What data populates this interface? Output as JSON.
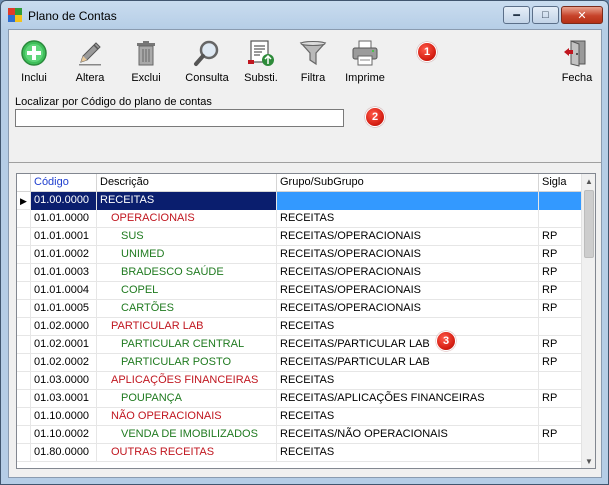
{
  "window": {
    "title": "Plano de Contas"
  },
  "toolbar": {
    "inclui": "Inclui",
    "altera": "Altera",
    "exclui": "Exclui",
    "consulta": "Consulta",
    "substi": "Substi.",
    "filtra": "Filtra",
    "imprime": "Imprime",
    "fecha": "Fecha"
  },
  "markers": {
    "m1": "1",
    "m2": "2",
    "m3": "3"
  },
  "search": {
    "label": "Localizar por Código do plano de contas",
    "value": ""
  },
  "grid": {
    "headers": {
      "codigo": "Código",
      "descricao": "Descrição",
      "grupo": "Grupo/SubGrupo",
      "sigla": "Sigla"
    },
    "rows": [
      {
        "codigo": "01.00.0000",
        "descricao": "RECEITAS",
        "grupo": "",
        "sigla": "",
        "level": 1
      },
      {
        "codigo": "01.01.0000",
        "descricao": "OPERACIONAIS",
        "grupo": "RECEITAS",
        "sigla": "",
        "level": 2
      },
      {
        "codigo": "01.01.0001",
        "descricao": "SUS",
        "grupo": "RECEITAS/OPERACIONAIS",
        "sigla": "RP",
        "level": 3
      },
      {
        "codigo": "01.01.0002",
        "descricao": "UNIMED",
        "grupo": "RECEITAS/OPERACIONAIS",
        "sigla": "RP",
        "level": 3
      },
      {
        "codigo": "01.01.0003",
        "descricao": "BRADESCO SAÚDE",
        "grupo": "RECEITAS/OPERACIONAIS",
        "sigla": "RP",
        "level": 3
      },
      {
        "codigo": "01.01.0004",
        "descricao": "COPEL",
        "grupo": "RECEITAS/OPERACIONAIS",
        "sigla": "RP",
        "level": 3
      },
      {
        "codigo": "01.01.0005",
        "descricao": "CARTÕES",
        "grupo": "RECEITAS/OPERACIONAIS",
        "sigla": "RP",
        "level": 3
      },
      {
        "codigo": "01.02.0000",
        "descricao": "PARTICULAR LAB",
        "grupo": "RECEITAS",
        "sigla": "",
        "level": 2
      },
      {
        "codigo": "01.02.0001",
        "descricao": "PARTICULAR CENTRAL",
        "grupo": "RECEITAS/PARTICULAR LAB",
        "sigla": "RP",
        "level": 3
      },
      {
        "codigo": "01.02.0002",
        "descricao": "PARTICULAR POSTO",
        "grupo": "RECEITAS/PARTICULAR LAB",
        "sigla": "RP",
        "level": 3
      },
      {
        "codigo": "01.03.0000",
        "descricao": "APLICAÇÕES FINANCEIRAS",
        "grupo": "RECEITAS",
        "sigla": "",
        "level": 2
      },
      {
        "codigo": "01.03.0001",
        "descricao": "POUPANÇA",
        "grupo": "RECEITAS/APLICAÇÕES FINANCEIRAS",
        "sigla": "RP",
        "level": 3
      },
      {
        "codigo": "01.10.0000",
        "descricao": "NÃO OPERACIONAIS",
        "grupo": "RECEITAS",
        "sigla": "",
        "level": 2
      },
      {
        "codigo": "01.10.0002",
        "descricao": "VENDA DE IMOBILIZADOS",
        "grupo": "RECEITAS/NÃO OPERACIONAIS",
        "sigla": "RP",
        "level": 3
      },
      {
        "codigo": "01.80.0000",
        "descricao": "OUTRAS RECEITAS",
        "grupo": "RECEITAS",
        "sigla": "",
        "level": 2
      }
    ]
  },
  "colors": {
    "selection_dark": "#0a1e6e",
    "selection_light": "#3399ff",
    "level2": "#c0161f",
    "level3": "#1f7a1f"
  }
}
